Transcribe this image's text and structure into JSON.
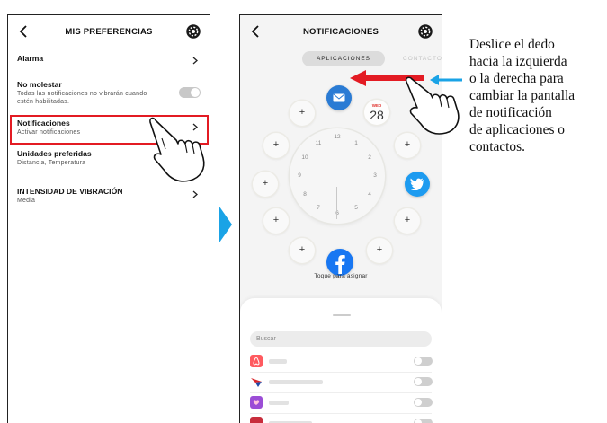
{
  "left_screen": {
    "title": "MIS PREFERENCIAS",
    "items": [
      {
        "title": "Alarma",
        "subtitle": ""
      },
      {
        "title": "No molestar",
        "subtitle": "Todas las notificaciones no vibrarán cuando estén habilitadas."
      },
      {
        "title": "Notificaciones",
        "subtitle": "Activar notificaciones"
      },
      {
        "title": "Unidades preferidas",
        "subtitle": "Distancia, Temperatura"
      },
      {
        "title": "INTENSIDAD DE VIBRACIÓN",
        "subtitle": "Media"
      }
    ],
    "subtitle_line_a": "Todas las notificaciones no vibrarán cuando",
    "subtitle_line_b": "estén habilitadas."
  },
  "right_screen": {
    "title": "NOTIFICACIONES",
    "tabs": [
      "APLICACIONES",
      "CONTACTOS"
    ],
    "active_tab": "APLICACIONES",
    "calendar": {
      "weekday": "WED",
      "day": "28"
    },
    "slot_add_label": "+",
    "clock_numbers": [
      "12",
      "1",
      "2",
      "3",
      "4",
      "5",
      "6",
      "7",
      "8",
      "9",
      "10",
      "11"
    ],
    "assign_hint": "Toque para asignar",
    "search_placeholder": "Buscar",
    "colors": {
      "mail": "#2a7bd4",
      "twitter": "#1d9bf0",
      "facebook": "#1877f2",
      "airbnb": "#ff5a5f",
      "app3": "#9b4dd6",
      "red_arrow": "#e31b23",
      "blue_arrow": "#1aa3e6"
    }
  },
  "instruction": [
    "Deslice el dedo",
    "hacia la izquierda",
    "o la derecha para",
    "cambiar la pantalla",
    "de notificación",
    "de aplicaciones o",
    "contactos."
  ]
}
